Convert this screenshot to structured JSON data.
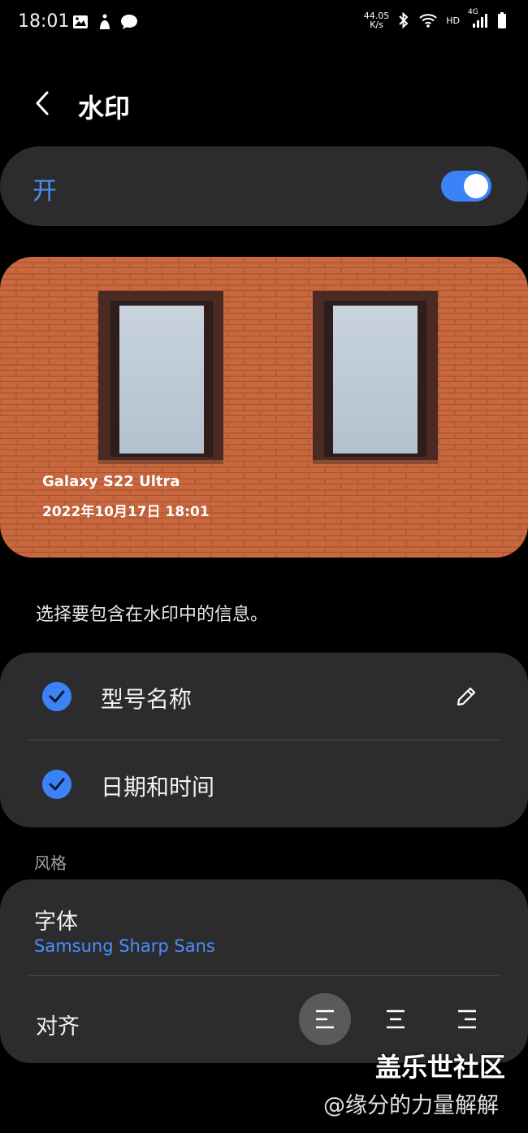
{
  "status_bar": {
    "time": "18:01",
    "net_speed_value": "44.05",
    "net_speed_unit": "K/s",
    "hd_label": "HD",
    "network_label": "4G",
    "icons": [
      "gallery-icon",
      "accessibility-icon",
      "chat-icon",
      "bluetooth-icon",
      "wifi-icon",
      "signal-icon",
      "battery-icon"
    ]
  },
  "header": {
    "title": "水印",
    "back_icon": "chevron-left-icon"
  },
  "master_toggle": {
    "label": "开",
    "state": "on",
    "accent": "#3b82f6"
  },
  "preview": {
    "model_text": "Galaxy S22 Ultra",
    "date_text": "2022年10月17日 18:01"
  },
  "description": "选择要包含在水印中的信息。",
  "options": [
    {
      "label": "型号名称",
      "checked": true,
      "editable": true
    },
    {
      "label": "日期和时间",
      "checked": true,
      "editable": false
    }
  ],
  "style_section": {
    "heading": "风格",
    "font_label": "字体",
    "font_value": "Samsung Sharp Sans",
    "align_label": "对齐",
    "align_options": [
      "align-left",
      "align-center",
      "align-right"
    ],
    "align_selected": "align-left"
  },
  "watermark_overlay": {
    "brand": "盖乐世社区",
    "credit": "@缘分的力量解解"
  },
  "colors": {
    "background": "#000000",
    "card": "#2c2c2e",
    "accent_text": "#4a90ff",
    "brick": "#c9683f"
  }
}
